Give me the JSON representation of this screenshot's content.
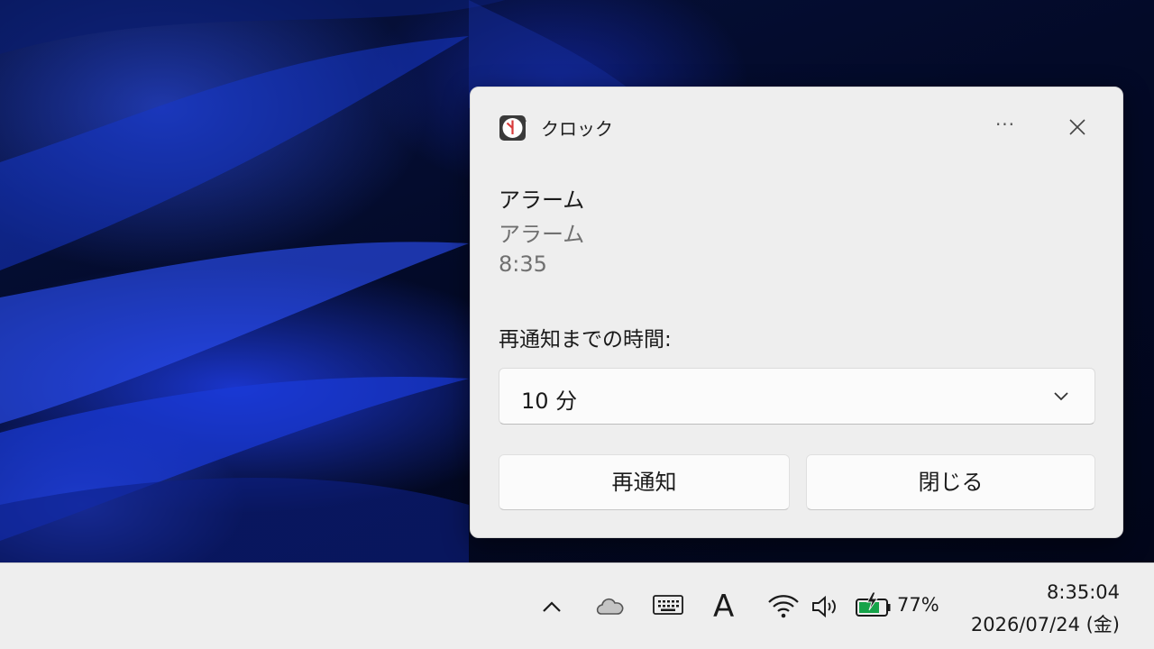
{
  "notification": {
    "app_name": "クロック",
    "more_label": "···",
    "title": "アラーム",
    "subtitle": "アラーム",
    "time": "8:35",
    "snooze_label": "再通知までの時間:",
    "snooze_dropdown": {
      "selected": "10 分"
    },
    "buttons": {
      "snooze": "再通知",
      "dismiss": "閉じる"
    }
  },
  "taskbar": {
    "ime_mode": "A",
    "battery_percent": "77%",
    "clock_time": "8:35:04",
    "clock_date": "2026/07/24 (金)"
  },
  "icons": {
    "app": "clock-icon",
    "more": "more-icon",
    "close": "close-icon",
    "dropdown": "chevron-down-icon",
    "tray": [
      "chevron-up-icon",
      "onedrive-cloud-icon",
      "keyboard-icon",
      "wifi-icon",
      "speaker-icon",
      "battery-charging-icon"
    ]
  },
  "colors": {
    "clock_accent": "#d83b3b",
    "battery_fill": "#16a34a"
  }
}
